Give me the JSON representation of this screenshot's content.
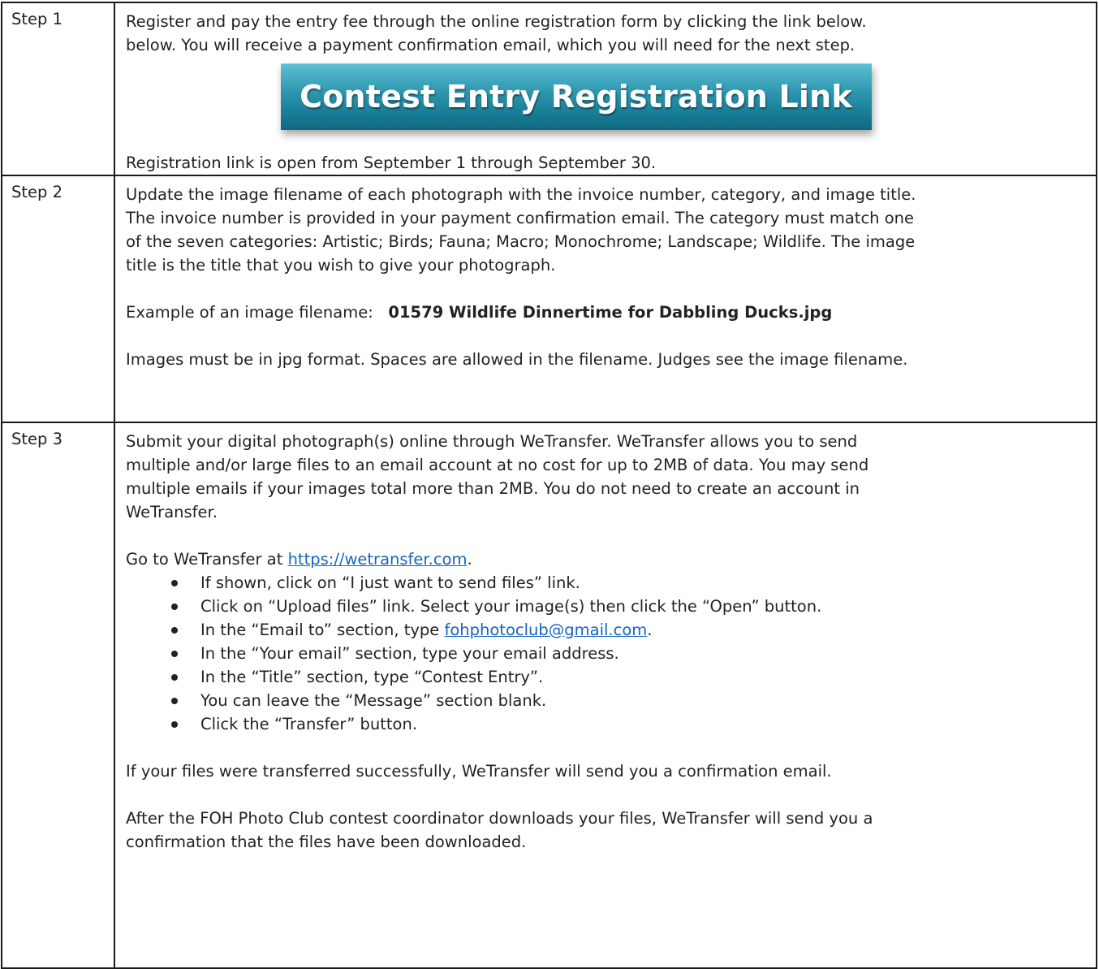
{
  "step1": {
    "label": "Step 1",
    "line1": "Register and pay the entry fee through the online registration form by clicking the link below.",
    "line2": "below. You will receive a payment confirmation email, which you will need for the next step.",
    "button_label": "Contest Entry Registration Link",
    "button_color": "#2c95ad",
    "footer": "Registration link is open from September 1 through September 30."
  },
  "step2": {
    "label": "Step 2",
    "lines": [
      "Update the image filename of each photograph with the invoice number, category, and image title.",
      "The invoice number is provided in your payment confirmation email. The category must match one",
      "of the seven categories: Artistic; Birds; Fauna; Macro; Monochrome; Landscape; Wildlife. The image",
      "title is the title that you wish to give your photograph."
    ],
    "example_label": "Example of an image filename:",
    "example_value": "01579 Wildlife Dinnertime for Dabbling Ducks.jpg",
    "note": "Images must be in jpg format. Spaces are allowed in the filename. Judges see the image filename."
  },
  "step3": {
    "label": "Step 3",
    "lines": [
      "Submit your digital photograph(s) online through WeTransfer. WeTransfer allows you to send",
      "multiple and/or large files to an email account at no cost for up to 2MB of data. You may send",
      "multiple emails if your images total more than 2MB. You do not need to create an account in",
      "WeTransfer."
    ],
    "goto_prefix": "Go to WeTransfer at ",
    "goto_link": "https://wetransfer.com",
    "goto_suffix": ".",
    "bullets": [
      "If shown, click on “I just want to send files” link.",
      "Click on “Upload files” link. Select your image(s) then click the “Open” button."
    ],
    "email_bullet_prefix": "In the “Email to” section, type ",
    "email_link": "fohphotoclub@gmail.com",
    "email_bullet_suffix": ".",
    "bullets_after": [
      "In the “Your email” section, type your email address.",
      "In the “Title” section, type “Contest Entry”.",
      "You can leave the “Message” section blank.",
      "Click the “Transfer” button."
    ],
    "success": "If your files were transferred successfully, WeTransfer will send you a confirmation email.",
    "after_lines": [
      "After the FOH Photo Club contest coordinator downloads your files, WeTransfer will send you a",
      "confirmation that the files have been downloaded."
    ],
    "link_color": "#1565c0"
  }
}
